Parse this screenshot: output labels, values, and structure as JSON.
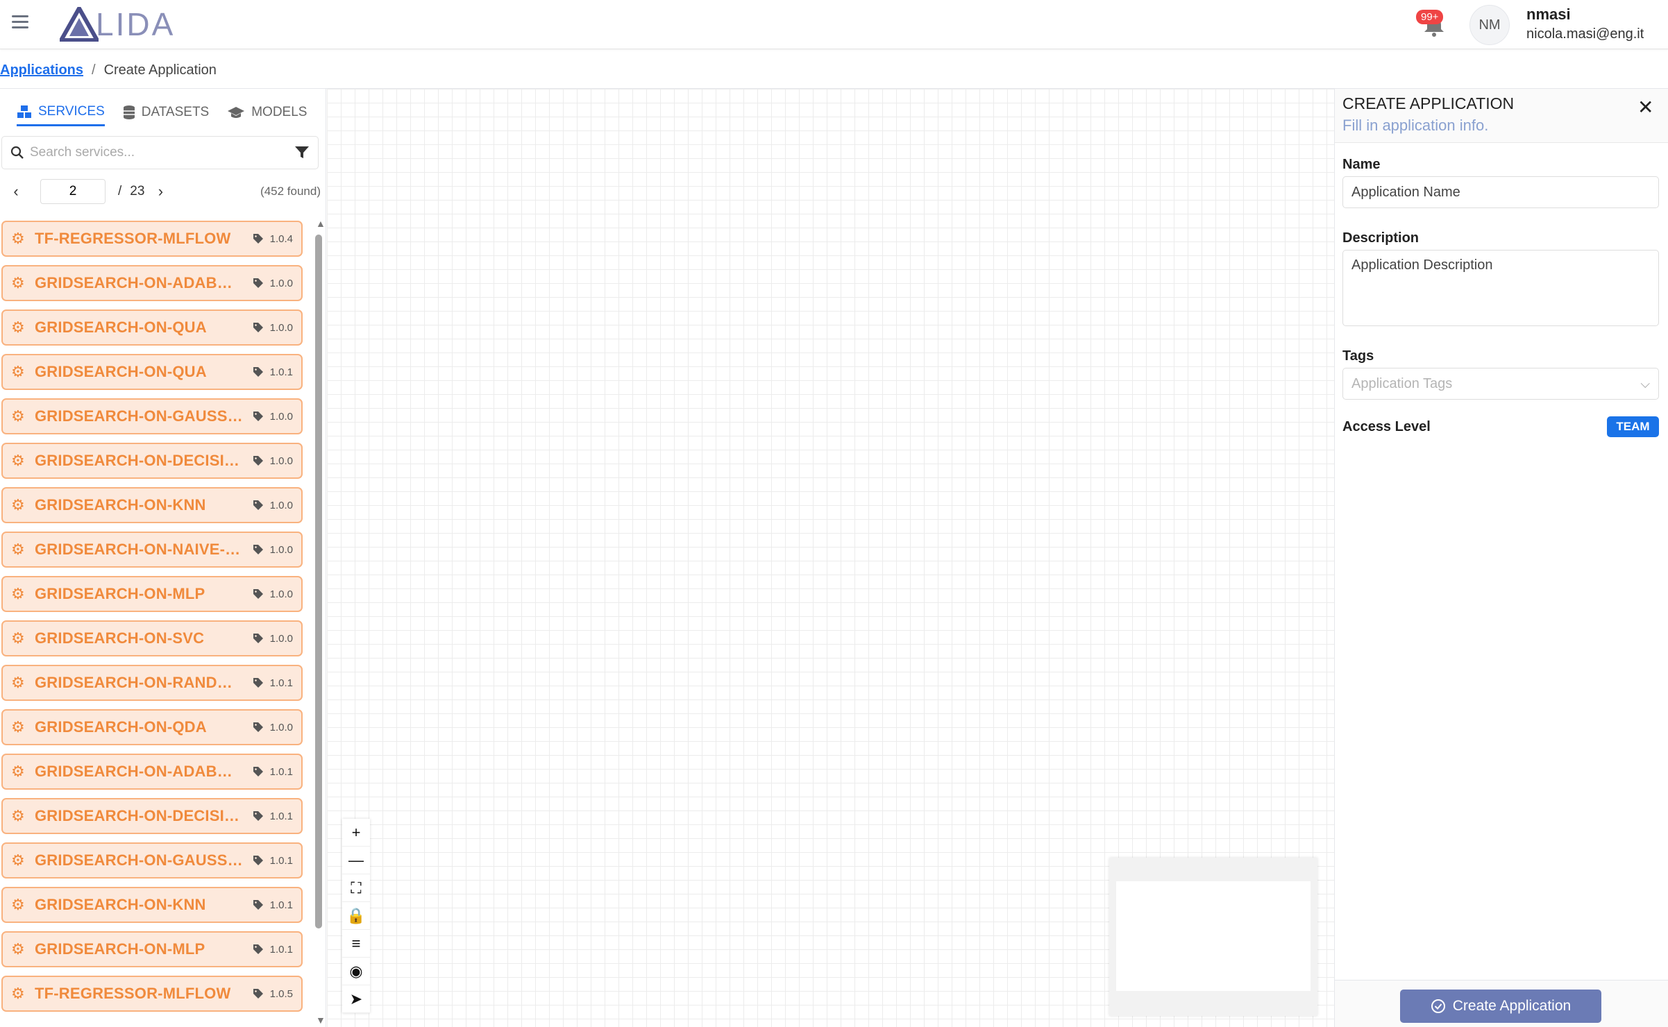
{
  "header": {
    "logo_text": "LIDA",
    "notifications_badge": "99+",
    "avatar_initials": "NM",
    "user_name": "nmasi",
    "user_email": "nicola.masi@eng.it"
  },
  "breadcrumb": {
    "link": "Applications",
    "separator": "/",
    "current": "Create Application"
  },
  "left_panel": {
    "tabs": [
      {
        "label": "SERVICES",
        "icon": "cubes-icon",
        "active": true
      },
      {
        "label": "DATASETS",
        "icon": "database-icon",
        "active": false
      },
      {
        "label": "MODELS",
        "icon": "graduation-cap-icon",
        "active": false
      }
    ],
    "search_placeholder": "Search services...",
    "pager": {
      "current_page": "2",
      "slash": "/",
      "total_pages": "23",
      "found": "(452 found)"
    },
    "services": [
      {
        "name": "TF-REGRESSOR-MLFLOW",
        "version": "1.0.4"
      },
      {
        "name": "GRIDSEARCH-ON-ADABOOST",
        "version": "1.0.0"
      },
      {
        "name": "GRIDSEARCH-ON-QUA",
        "version": "1.0.0"
      },
      {
        "name": "GRIDSEARCH-ON-QUA",
        "version": "1.0.1"
      },
      {
        "name": "GRIDSEARCH-ON-GAUSSIAN...",
        "version": "1.0.0"
      },
      {
        "name": "GRIDSEARCH-ON-DECISION...",
        "version": "1.0.0"
      },
      {
        "name": "GRIDSEARCH-ON-KNN",
        "version": "1.0.0"
      },
      {
        "name": "GRIDSEARCH-ON-NAIVE-BA...",
        "version": "1.0.0"
      },
      {
        "name": "GRIDSEARCH-ON-MLP",
        "version": "1.0.0"
      },
      {
        "name": "GRIDSEARCH-ON-SVC",
        "version": "1.0.0"
      },
      {
        "name": "GRIDSEARCH-ON-RANDOM...",
        "version": "1.0.1"
      },
      {
        "name": "GRIDSEARCH-ON-QDA",
        "version": "1.0.0"
      },
      {
        "name": "GRIDSEARCH-ON-ADABOOST",
        "version": "1.0.1"
      },
      {
        "name": "GRIDSEARCH-ON-DECISION...",
        "version": "1.0.1"
      },
      {
        "name": "GRIDSEARCH-ON-GAUSSIAN...",
        "version": "1.0.1"
      },
      {
        "name": "GRIDSEARCH-ON-KNN",
        "version": "1.0.1"
      },
      {
        "name": "GRIDSEARCH-ON-MLP",
        "version": "1.0.1"
      },
      {
        "name": "TF-REGRESSOR-MLFLOW",
        "version": "1.0.5"
      }
    ]
  },
  "canvas_controls": [
    {
      "name": "zoom-in-icon",
      "glyph": "+"
    },
    {
      "name": "zoom-out-icon",
      "glyph": "—"
    },
    {
      "name": "fit-view-icon",
      "glyph": "⛶"
    },
    {
      "name": "lock-icon",
      "glyph": "🔒"
    },
    {
      "name": "menu-icon",
      "glyph": "≡"
    },
    {
      "name": "hide-icon",
      "glyph": "◉"
    },
    {
      "name": "navigate-icon",
      "glyph": "➤"
    }
  ],
  "right_panel": {
    "title": "CREATE APPLICATION",
    "subtitle": "Fill in application info.",
    "name_label": "Name",
    "name_value": "Application Name",
    "description_label": "Description",
    "description_value": "Application Description",
    "tags_label": "Tags",
    "tags_placeholder": "Application Tags",
    "access_level_label": "Access Level",
    "access_level_value": "TEAM",
    "create_button": "Create Application"
  },
  "colors": {
    "accent": "#1f6feb",
    "service_fill": "#fde9dc",
    "service_border": "#f9b27f",
    "service_text": "#f08a3c",
    "create_button": "#6b7bb5",
    "badge": "#ef4444"
  }
}
